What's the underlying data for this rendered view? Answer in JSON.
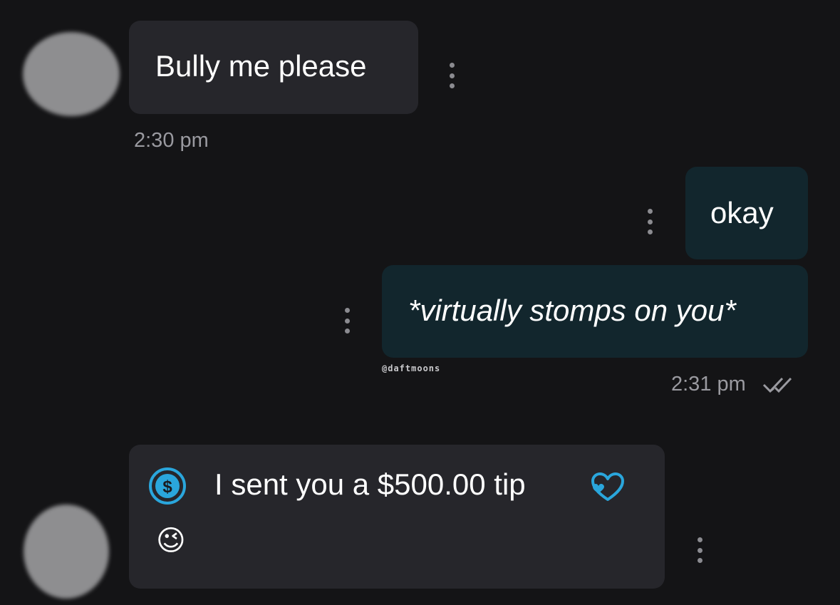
{
  "messages": [
    {
      "text": "Bully me please",
      "time": "2:30 pm",
      "direction": "incoming"
    },
    {
      "text": "okay",
      "direction": "outgoing"
    },
    {
      "text": "*virtually stomps on you*",
      "time": "2:31 pm",
      "direction": "outgoing",
      "status": "read"
    },
    {
      "text": "I sent you a $500.00 tip",
      "emoji": "😉",
      "direction": "incoming",
      "type": "tip"
    }
  ],
  "watermark": "@daftmoons",
  "icons": {
    "tip": "dollar-coin-icon",
    "heart": "heart-icon",
    "menu": "vertical-dots-icon",
    "read_receipt": "double-check-icon"
  },
  "colors": {
    "background": "#141416",
    "incoming_bubble": "#26262b",
    "outgoing_bubble": "#12262d",
    "accent": "#2aa6dc",
    "muted_text": "#9a9aa0"
  }
}
